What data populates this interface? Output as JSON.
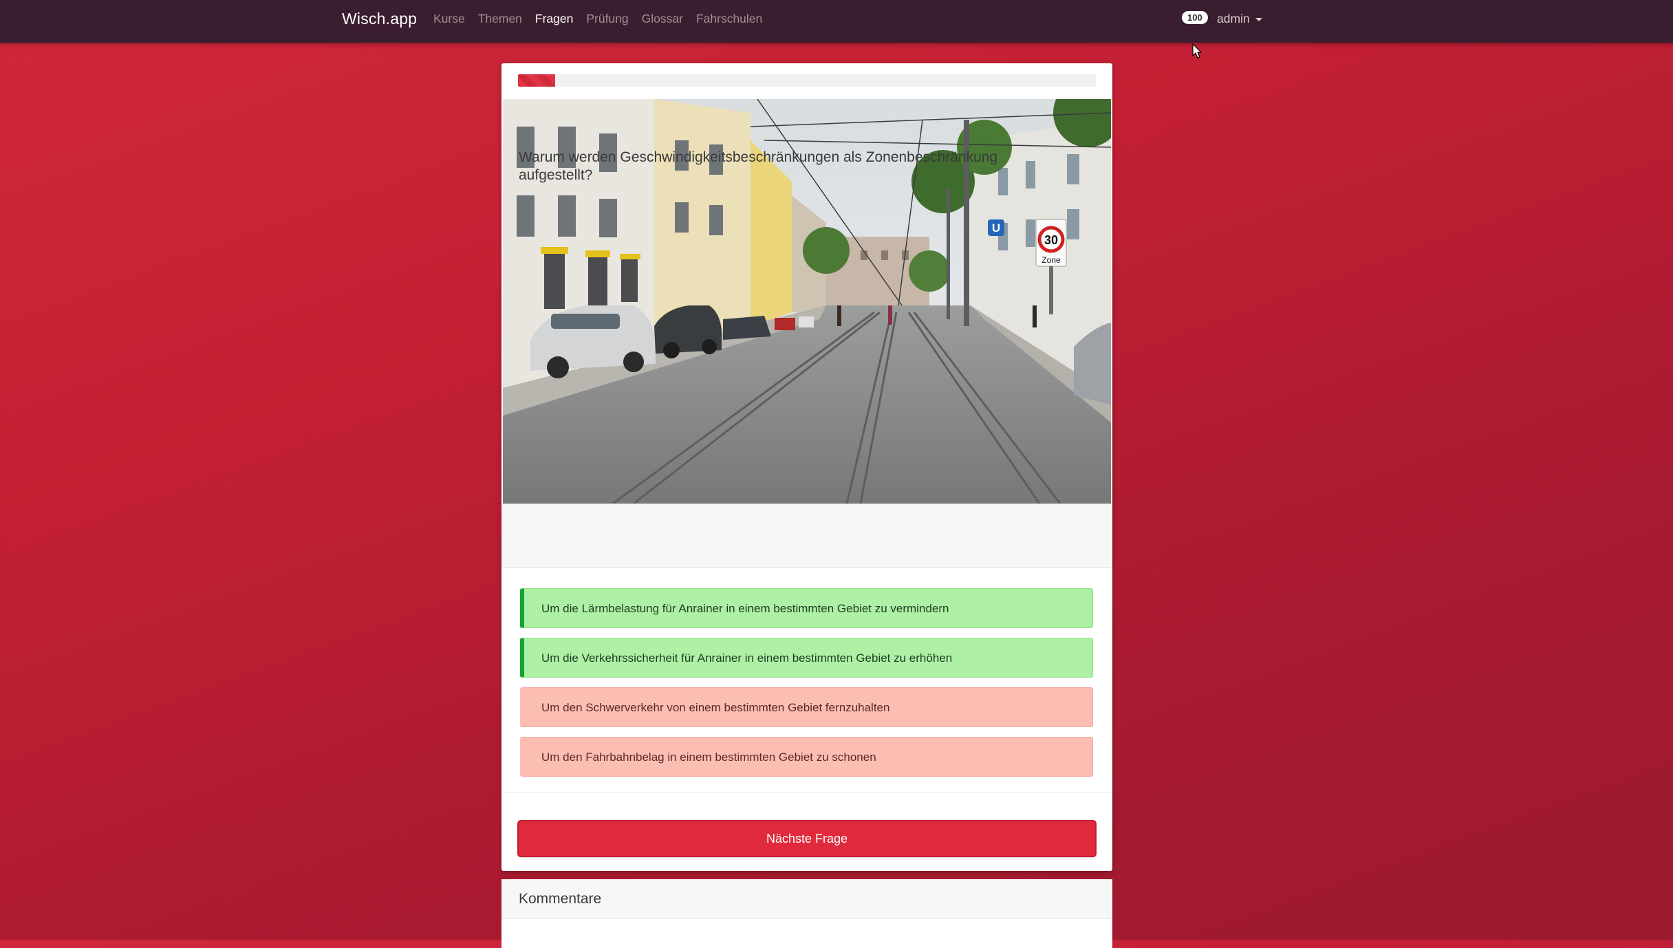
{
  "nav": {
    "brand": "Wisch.app",
    "links": [
      "Kurse",
      "Themen",
      "Fragen",
      "Prüfung",
      "Glossar",
      "Fahrschulen"
    ],
    "active_index": 2,
    "badge": "100",
    "user": "admin"
  },
  "quiz": {
    "progress": 0.064,
    "image": {
      "sign_speed": "30",
      "sign_zone": "Zone",
      "metro_letter": "U"
    },
    "question": "Warum werden Geschwindigkeitsbeschränkungen als Zonenbeschränkung aufgestellt?",
    "answers": [
      {
        "text": "Um die Lärmbelastung für Anrainer in einem bestimmten Gebiet zu vermindern",
        "state": "correct"
      },
      {
        "text": "Um die Verkehrssicherheit für Anrainer in einem bestimmten Gebiet zu erhöhen",
        "state": "correct"
      },
      {
        "text": "Um den Schwerverkehr von einem bestimmten Gebiet fernzuhalten",
        "state": "wrong"
      },
      {
        "text": "Um den Fahrbahnbelag in einem bestimmten Gebiet zu schonen",
        "state": "wrong"
      }
    ],
    "next_label": "Nächste Frage"
  },
  "comments": {
    "title": "Kommentare"
  },
  "colors": {
    "brand_red": "#e02a3c",
    "navbar": "#3a1d2e",
    "correct_bg": "#aef0a6",
    "wrong_bg": "#fcbdb3"
  }
}
